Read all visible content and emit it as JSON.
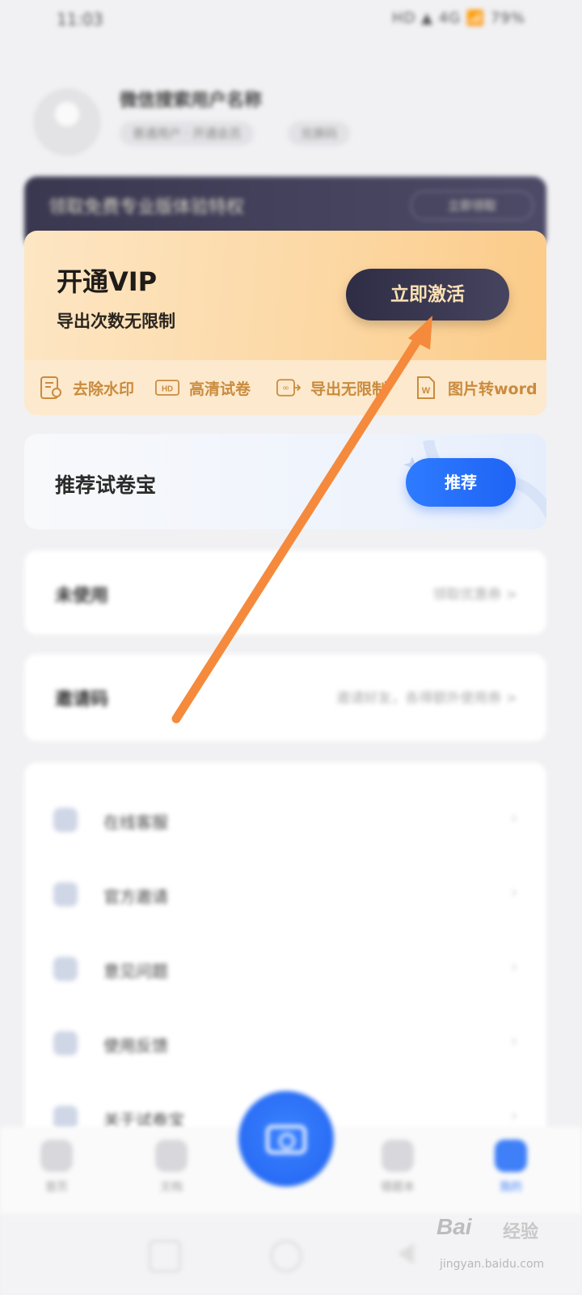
{
  "status_bar": {
    "time": "11:03",
    "right": "HD ▲ 4G 📶 79%"
  },
  "profile": {
    "name": "微信搜索用户名称",
    "chip1": "普通用户 · 开通会员",
    "chip2": "兑换码"
  },
  "dark_banner": {
    "text": "领取免费专业版体验特权",
    "button": "立即领取"
  },
  "vip": {
    "title": "开通VIP",
    "subtitle": "导出次数无限制",
    "activate_button": "立即激活",
    "features": [
      {
        "icon": "watermark-remove-icon",
        "label": "去除水印"
      },
      {
        "icon": "hd-icon",
        "label": "高清试卷"
      },
      {
        "icon": "infinite-export-icon",
        "label": "导出无限制"
      },
      {
        "icon": "word-icon",
        "label": "图片转word"
      }
    ]
  },
  "recommend": {
    "title": "推荐试卷宝",
    "button": "推荐"
  },
  "rows": [
    {
      "key": "未使用",
      "value": "领取优惠券 >"
    },
    {
      "key": "邀请码",
      "value": "邀请好友，各得额外使用券 >"
    }
  ],
  "menu": [
    {
      "icon": "service-icon",
      "label": "在线客服"
    },
    {
      "icon": "share-icon",
      "label": "官方邀请"
    },
    {
      "icon": "feedback-icon",
      "label": "意见问题"
    },
    {
      "icon": "settings-icon",
      "label": "使用反馈"
    },
    {
      "icon": "about-icon",
      "label": "关于试卷宝"
    }
  ],
  "tabs": [
    {
      "label": "首页",
      "icon": "home-icon"
    },
    {
      "label": "文档",
      "icon": "document-icon"
    },
    {
      "label": "错题本",
      "icon": "notebook-icon"
    },
    {
      "label": "我的",
      "icon": "profile-icon"
    }
  ],
  "watermark": {
    "logo": "Bai",
    "brand": "经验",
    "url": "jingyan.baidu.com"
  },
  "colors": {
    "accent": "#2e7bff",
    "vip_gold": "#c98b3e",
    "arrow": "#f58a3c",
    "dark_button": "#2f2d45"
  }
}
